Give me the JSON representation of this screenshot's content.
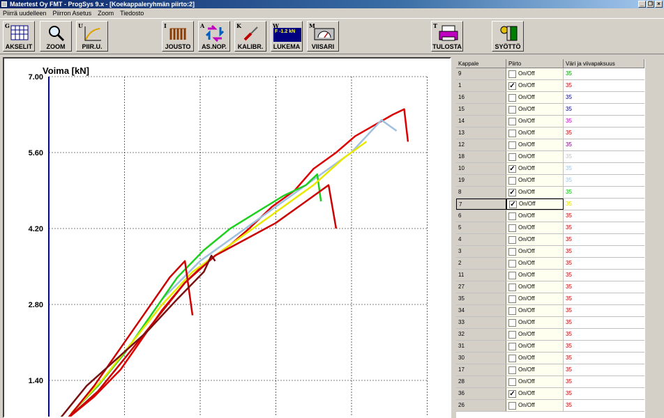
{
  "window": {
    "title": "Matertest Oy   FMT - ProgSys 9.x - [Koekappaleryhmän piirto:2]",
    "buttons": {
      "minimize": "_",
      "restore": "❐",
      "close": "×"
    }
  },
  "menu": [
    "Piirrä uudelleen",
    "Piirron Asetus",
    "Zoom",
    "Tiedosto"
  ],
  "toolbar": {
    "akselit": {
      "key": "G",
      "label": "AKSELIT"
    },
    "zoom": {
      "key": "",
      "label": "ZOOM"
    },
    "piiru": {
      "key": "U",
      "label": "PIIR.U."
    },
    "jousto": {
      "key": "I",
      "label": "JOUSTO"
    },
    "asnop": {
      "key": "A",
      "label": "AS.NOP."
    },
    "kalibr": {
      "key": "K",
      "label": "KALIBR."
    },
    "lukema": {
      "key": "W",
      "label": "LUKEMA",
      "display_value": "F -1.2 kN"
    },
    "viisari": {
      "key": "M",
      "label": "VIISARI"
    },
    "tulosta": {
      "key": "T",
      "label": "TULOSTA"
    },
    "syotto": {
      "key": "",
      "label": "SYÖTTÖ"
    }
  },
  "table": {
    "headers": [
      "Kappale",
      "Piirto",
      "Väri ja viivapaksuus"
    ],
    "onoff_label": "On/Off",
    "rows": [
      {
        "id": "9",
        "checked": false,
        "value": "35",
        "color": "#00a000"
      },
      {
        "id": "1",
        "checked": true,
        "value": "35",
        "color": "#cc0000"
      },
      {
        "id": "16",
        "checked": false,
        "value": "35",
        "color": "#000080"
      },
      {
        "id": "15",
        "checked": false,
        "value": "35",
        "color": "#000080"
      },
      {
        "id": "14",
        "checked": false,
        "value": "35",
        "color": "#c000c0"
      },
      {
        "id": "13",
        "checked": false,
        "value": "35",
        "color": "#cc0000"
      },
      {
        "id": "12",
        "checked": false,
        "value": "35",
        "color": "#800080"
      },
      {
        "id": "18",
        "checked": false,
        "value": "35",
        "color": "#c0c0c0"
      },
      {
        "id": "10",
        "checked": true,
        "value": "35",
        "color": "#a0c0e0"
      },
      {
        "id": "19",
        "checked": false,
        "value": "35",
        "color": "#a0c0e0"
      },
      {
        "id": "8",
        "checked": true,
        "value": "35",
        "color": "#00c000"
      },
      {
        "id": "7",
        "checked": true,
        "value": "35",
        "color": "#e0e000",
        "selected": true
      },
      {
        "id": "6",
        "checked": false,
        "value": "35",
        "color": "#cc0000"
      },
      {
        "id": "5",
        "checked": false,
        "value": "35",
        "color": "#cc0000"
      },
      {
        "id": "4",
        "checked": false,
        "value": "35",
        "color": "#cc0000"
      },
      {
        "id": "3",
        "checked": false,
        "value": "35",
        "color": "#cc0000"
      },
      {
        "id": "2",
        "checked": false,
        "value": "35",
        "color": "#cc0000"
      },
      {
        "id": "11",
        "checked": false,
        "value": "35",
        "color": "#cc0000"
      },
      {
        "id": "27",
        "checked": false,
        "value": "35",
        "color": "#cc0000"
      },
      {
        "id": "35",
        "checked": false,
        "value": "35",
        "color": "#cc0000"
      },
      {
        "id": "34",
        "checked": false,
        "value": "35",
        "color": "#cc0000"
      },
      {
        "id": "33",
        "checked": false,
        "value": "35",
        "color": "#cc0000"
      },
      {
        "id": "32",
        "checked": false,
        "value": "35",
        "color": "#cc0000"
      },
      {
        "id": "31",
        "checked": false,
        "value": "35",
        "color": "#cc0000"
      },
      {
        "id": "30",
        "checked": false,
        "value": "35",
        "color": "#cc0000"
      },
      {
        "id": "17",
        "checked": false,
        "value": "35",
        "color": "#cc0000"
      },
      {
        "id": "28",
        "checked": false,
        "value": "35",
        "color": "#cc0000"
      },
      {
        "id": "36",
        "checked": true,
        "value": "35",
        "color": "#cc0000"
      },
      {
        "id": "26",
        "checked": false,
        "value": "35",
        "color": "#cc0000"
      }
    ]
  },
  "chart_data": {
    "type": "line",
    "ylabel": "Voima  [kN]",
    "yticks": [
      "7.00",
      "5.60",
      "4.20",
      "2.80",
      "1.40"
    ],
    "ylim": [
      0.7,
      7.0
    ],
    "xlim": [
      0,
      10
    ],
    "grid": true,
    "series": [
      {
        "color": "#dd0000",
        "x": [
          0.5,
          1.2,
          1.9,
          2.5,
          3.0,
          3.6,
          4.2,
          4.8,
          5.3,
          5.9,
          6.5,
          7.0,
          7.6,
          8.1,
          8.6,
          9.1,
          9.4,
          9.5
        ],
        "y": [
          0.7,
          1.1,
          1.6,
          2.2,
          2.7,
          3.2,
          3.6,
          3.9,
          4.2,
          4.6,
          4.9,
          5.3,
          5.6,
          5.9,
          6.1,
          6.3,
          6.4,
          5.8
        ]
      },
      {
        "color": "#a0c0e0",
        "x": [
          3.0,
          4.0,
          5.0,
          6.0,
          7.0,
          8.0,
          8.8,
          9.2
        ],
        "y": [
          2.9,
          3.6,
          4.1,
          4.6,
          5.1,
          5.6,
          6.2,
          6.0
        ]
      },
      {
        "color": "#20d020",
        "x": [
          0.6,
          1.3,
          2.0,
          2.7,
          3.4,
          4.1,
          4.8,
          5.5,
          6.2,
          6.8,
          7.1,
          7.2
        ],
        "y": [
          0.8,
          1.3,
          1.9,
          2.6,
          3.3,
          3.8,
          4.2,
          4.5,
          4.8,
          5.0,
          5.2,
          4.7
        ]
      },
      {
        "color": "#e8e800",
        "x": [
          0.6,
          1.4,
          2.2,
          3.0,
          3.8,
          4.6,
          5.4,
          6.2,
          7.0,
          7.8,
          8.4
        ],
        "y": [
          0.8,
          1.4,
          2.1,
          2.8,
          3.4,
          3.8,
          4.2,
          4.6,
          5.0,
          5.5,
          5.8
        ]
      },
      {
        "color": "#cc0000",
        "x": [
          0.5,
          1.3,
          2.0,
          2.8,
          3.6,
          4.4,
          5.2,
          6.0,
          6.8,
          7.4,
          7.6
        ],
        "y": [
          0.7,
          1.2,
          1.8,
          2.5,
          3.2,
          3.7,
          4.0,
          4.3,
          4.7,
          5.0,
          4.2
        ]
      },
      {
        "color": "#cc0000",
        "x": [
          0.5,
          1.2,
          1.9,
          2.6,
          3.2,
          3.6,
          3.8
        ],
        "y": [
          0.7,
          1.3,
          2.0,
          2.7,
          3.3,
          3.6,
          2.6
        ]
      },
      {
        "color": "#7a1010",
        "x": [
          0.3,
          1.0,
          1.8,
          2.6,
          3.4,
          4.1,
          4.3,
          4.4
        ],
        "y": [
          0.7,
          1.3,
          1.8,
          2.3,
          2.9,
          3.4,
          3.7,
          3.6
        ]
      }
    ]
  }
}
